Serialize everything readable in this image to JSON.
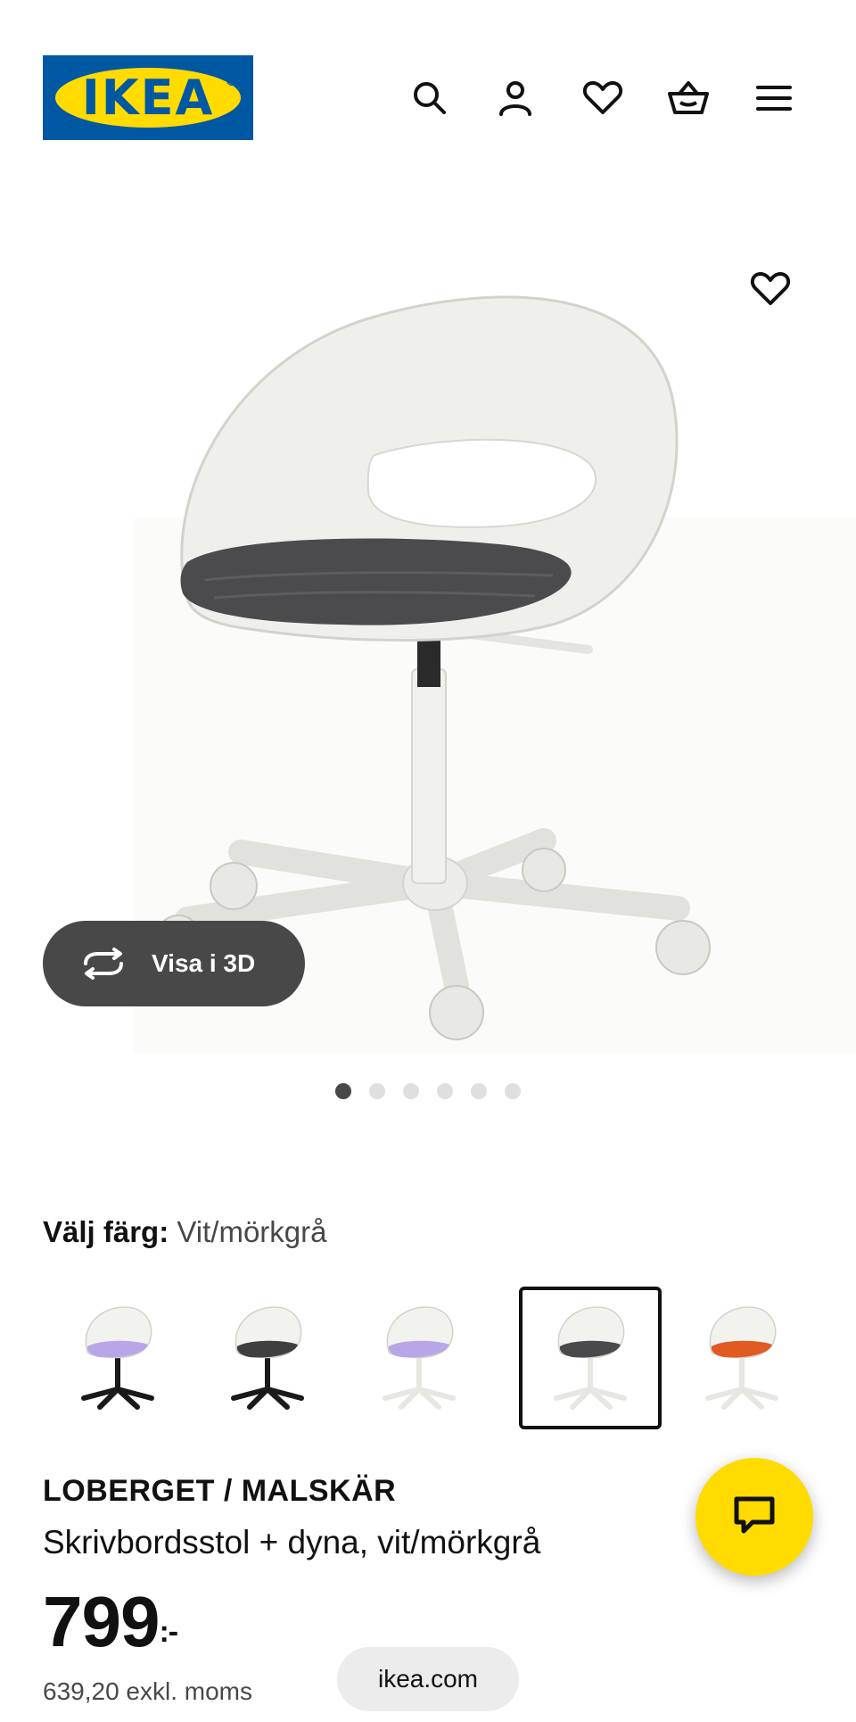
{
  "header": {
    "logo_text": "IKEA",
    "icons": [
      "search-icon",
      "account-icon",
      "heart-icon",
      "basket-icon",
      "menu-icon"
    ]
  },
  "hero": {
    "image_label": "LOBERGET / MALSKÄR",
    "view_3d_label": "Visa i 3D",
    "image_count": 6,
    "active_image": 1
  },
  "color_picker": {
    "label": "Välj färg:",
    "selected_value": "Vit/mörkgrå",
    "swatches": [
      {
        "seat": "#b9a6e8",
        "frame": "#1a1a1a",
        "selected": false
      },
      {
        "seat": "#3f3f3f",
        "frame": "#1a1a1a",
        "selected": false
      },
      {
        "seat": "#b9a6e8",
        "frame": "#e6e6e2",
        "selected": false
      },
      {
        "seat": "#4a4a4c",
        "frame": "#e6e6e2",
        "selected": true
      },
      {
        "seat": "#e05a22",
        "frame": "#e6e6e2",
        "selected": false
      }
    ]
  },
  "product": {
    "name": "LOBERGET / MALSKÄR",
    "description": "Skrivbordsstol + dyna, vit/mörkgrå",
    "price": "799",
    "price_suffix": ":-",
    "price_ex_vat": "639,20 exkl. moms"
  },
  "chat_button": {
    "icon": "chat-icon"
  },
  "browser": {
    "url": "ikea.com"
  },
  "colors": {
    "ikea_blue": "#0058a3",
    "ikea_yellow": "#ffdb00",
    "dark_grey": "#484848"
  }
}
